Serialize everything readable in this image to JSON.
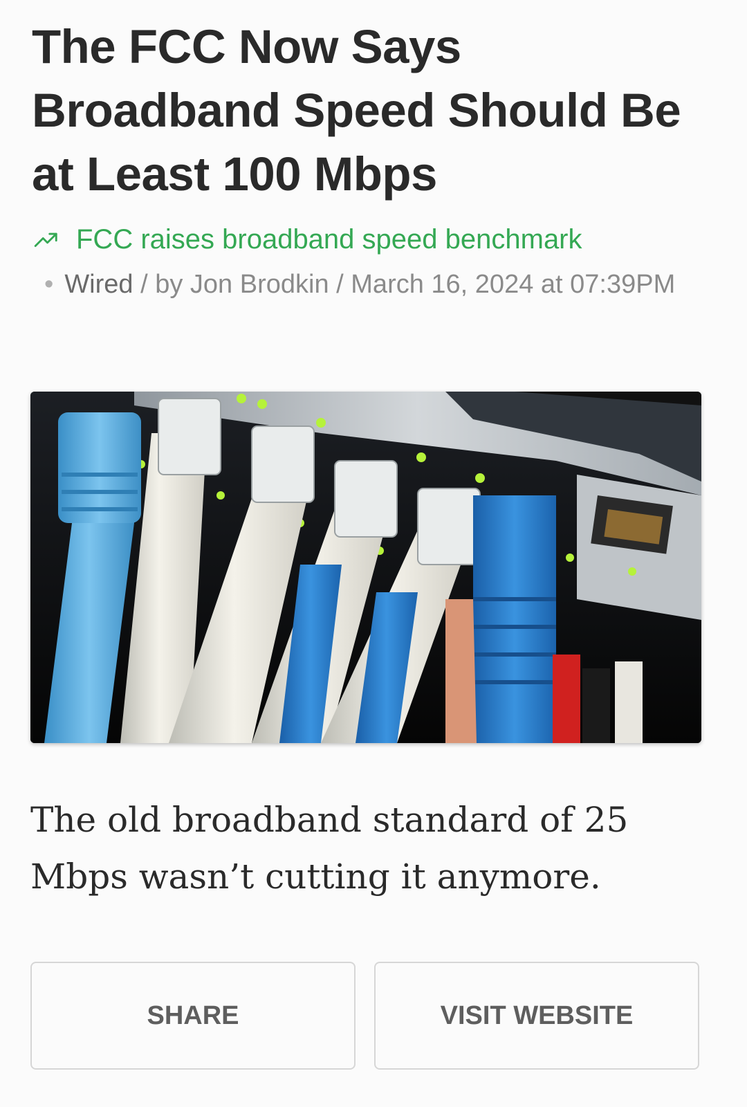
{
  "article": {
    "headline": "The FCC Now Says Broadband Speed Should Be at Least 100 Mbps",
    "topic": {
      "icon": "trending-up-icon",
      "label": "FCC raises broadband speed benchmark",
      "color": "#34a853"
    },
    "meta": {
      "separator": "•",
      "source": "Wired",
      "author_prefix": " / by ",
      "author": "Jon Brodkin",
      "date_prefix": " / ",
      "date": "March 16, 2024 at 07:39PM"
    },
    "image": {
      "subject": "ethernet cables plugged into a network switch"
    },
    "summary": "The old broadband standard of 25 Mbps wasn’t cutting it anymore."
  },
  "actions": {
    "share_label": "SHARE",
    "visit_label": "VISIT WEBSITE"
  }
}
